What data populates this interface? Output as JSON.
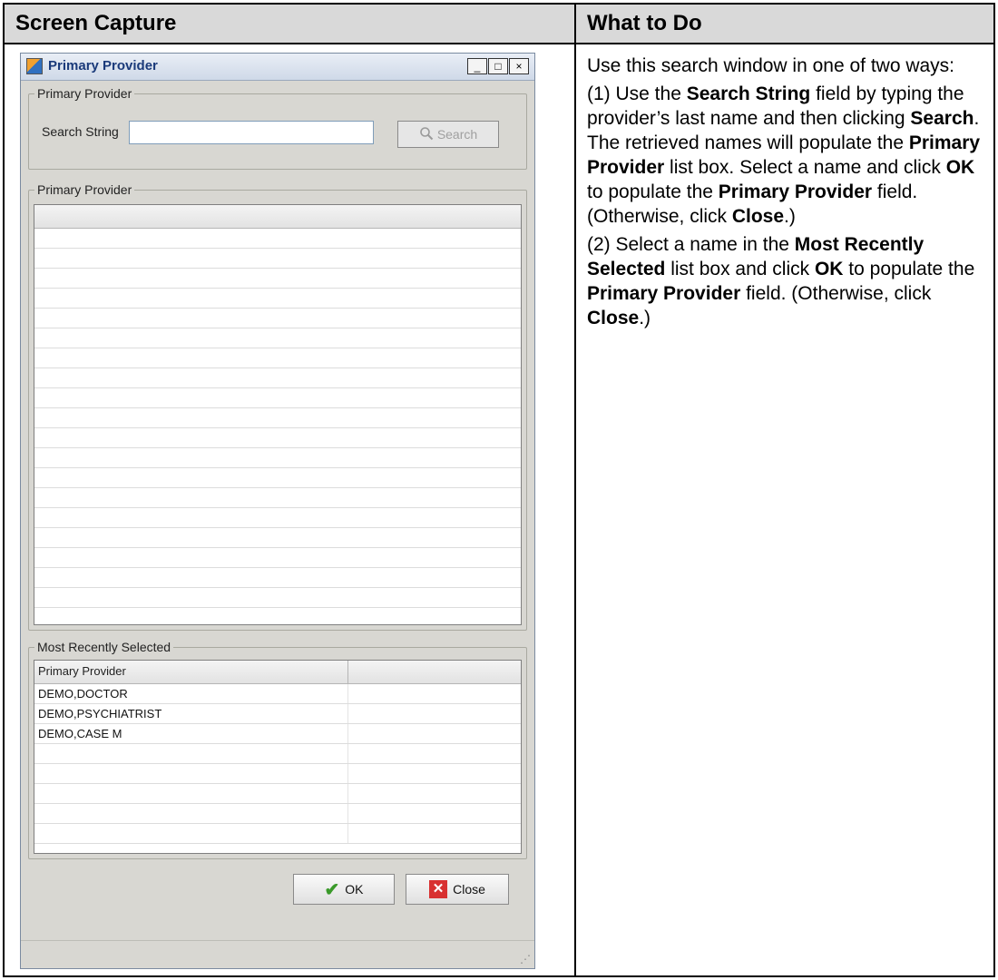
{
  "headers": {
    "screen_capture": "Screen Capture",
    "what_to_do": "What to Do"
  },
  "dialog": {
    "title": "Primary Provider",
    "window_buttons": {
      "minimize": "_",
      "maximize": "□",
      "close": "×"
    },
    "search_group": {
      "legend": "Primary Provider",
      "search_label": "Search String",
      "search_value": "",
      "search_button": "Search"
    },
    "results_group": {
      "legend": "Primary Provider",
      "rows": []
    },
    "recent_group": {
      "legend": "Most Recently Selected",
      "column_header": "Primary Provider",
      "rows": [
        "DEMO,DOCTOR",
        "DEMO,PSYCHIATRIST",
        "DEMO,CASE M"
      ]
    },
    "ok_button": "OK",
    "close_button": "Close"
  },
  "instructions": {
    "intro": "Use this search window in one of two ways:",
    "step1": {
      "t1": "(1) Use the ",
      "b1": "Search String",
      "t2": " field by typing the provider’s last name and then clicking ",
      "b2": "Search",
      "t3": ". The retrieved names will populate the ",
      "b3": "Primary Provider",
      "t4": " list box. Select a name and click ",
      "b4": "OK",
      "t5": " to populate the ",
      "b5": "Primary Provider",
      "t6": " field. (Otherwise, click ",
      "b6": "Close",
      "t7": ".)"
    },
    "step2": {
      "t1": "(2) Select a name in the ",
      "b1": "Most Recently Selected",
      "t2": " list box and click ",
      "b2": "OK",
      "t3": " to populate the ",
      "b3": "Primary Provider",
      "t4": " field. (Otherwise, click ",
      "b4": "Close",
      "t5": ".)"
    }
  }
}
